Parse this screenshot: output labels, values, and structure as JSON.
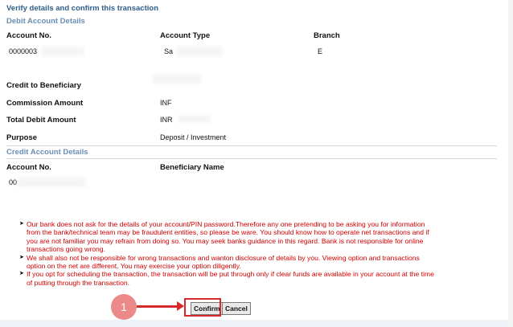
{
  "header": {
    "title": "Verify details and confirm this transaction"
  },
  "debit": {
    "section_title": "Debit Account Details",
    "labels": {
      "account_no": "Account No.",
      "account_type": "Account Type",
      "branch": "Branch"
    },
    "values": {
      "account_no": "0000003",
      "account_type": "Sa",
      "branch": "E"
    }
  },
  "credit_beneficiary_label": "Credit to Beneficiary",
  "commission": {
    "label": "Commission Amount",
    "value": "INF"
  },
  "total_debit": {
    "label": "Total Debit Amount",
    "value": "INR"
  },
  "purpose": {
    "label": "Purpose",
    "value": "Deposit / Investment"
  },
  "credit": {
    "section_title": "Credit Account Details",
    "labels": {
      "account_no": "Account No.",
      "beneficiary_name": "Beneficiary Name"
    },
    "values": {
      "account_no": "00"
    }
  },
  "notes": [
    "Our bank does not ask for the details of your account/PIN password.Therefore any one pretending to be asking you for information from the bank/technical team may be fraudulent entities, so please be ware. You should know how to operate net transactions and if you are not familiar you may refrain from doing so. You may seek banks guidance in this regard. Bank is not responsible for online transactions going wrong.",
    "We shall also not be responsible for wrong transactions and wanton disclosure of details by you. Viewing option and transactions option on the net are different. You may exercise your option diligently.",
    "If you opt for scheduling the transaction, the transaction will be put through only if clear funds are available in your account at the time of putting through the transaction."
  ],
  "buttons": {
    "confirm": "Confirm",
    "cancel": "Cancel"
  },
  "annotation": {
    "step": "1",
    "color": "#d62a2a"
  }
}
